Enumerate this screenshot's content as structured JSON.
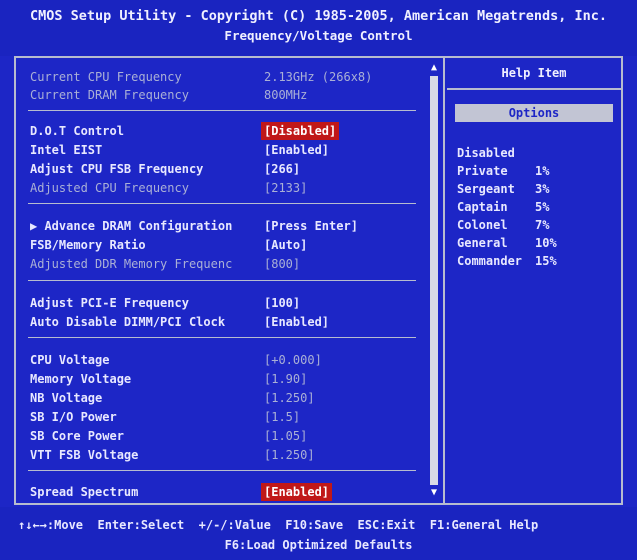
{
  "header": {
    "title": "CMOS Setup Utility - Copyright (C) 1985-2005, American Megatrends, Inc.",
    "subtitle": "Frequency/Voltage Control"
  },
  "settings": {
    "current_cpu_freq": {
      "label": "Current CPU Frequency",
      "value": "2.13GHz (266x8)"
    },
    "current_dram_freq": {
      "label": "Current DRAM Frequency",
      "value": "800MHz"
    },
    "dot_control": {
      "label": "D.O.T Control",
      "value": "[Disabled]"
    },
    "intel_eist": {
      "label": "Intel EIST",
      "value": "[Enabled]"
    },
    "adjust_fsb": {
      "label": "Adjust CPU FSB Frequency",
      "value": "[266]"
    },
    "adjusted_cpu": {
      "label": "Adjusted CPU Frequency",
      "value": "[2133]"
    },
    "advance_dram": {
      "label": "▶ Advance DRAM Configuration",
      "value": "[Press Enter]"
    },
    "fsb_mem_ratio": {
      "label": "FSB/Memory Ratio",
      "value": "[Auto]"
    },
    "adjusted_ddr": {
      "label": "Adjusted DDR Memory Frequenc",
      "value": "[800]"
    },
    "adjust_pcie": {
      "label": "Adjust PCI-E Frequency",
      "value": "[100]"
    },
    "auto_disable": {
      "label": "Auto Disable DIMM/PCI Clock",
      "value": "[Enabled]"
    },
    "cpu_voltage": {
      "label": "CPU Voltage",
      "value": "[+0.000]"
    },
    "memory_voltage": {
      "label": "Memory Voltage",
      "value": "[1.90]"
    },
    "nb_voltage": {
      "label": "NB Voltage",
      "value": "[1.250]"
    },
    "sb_io_power": {
      "label": "SB I/O Power",
      "value": "[1.5]"
    },
    "sb_core_power": {
      "label": "SB Core Power",
      "value": "[1.05]"
    },
    "vtt_fsb": {
      "label": "VTT FSB Voltage",
      "value": "[1.250]"
    },
    "spread_spectrum": {
      "label": "Spread Spectrum",
      "value": "[Enabled]"
    }
  },
  "help": {
    "title": "Help Item",
    "options_title": "Options",
    "options": [
      {
        "name": "Disabled",
        "value": ""
      },
      {
        "name": "Private",
        "value": "1%"
      },
      {
        "name": "Sergeant",
        "value": "3%"
      },
      {
        "name": "Captain",
        "value": "5%"
      },
      {
        "name": "Colonel",
        "value": "7%"
      },
      {
        "name": "General",
        "value": "10%"
      },
      {
        "name": "Commander",
        "value": "15%"
      }
    ]
  },
  "footer": {
    "line1": "↑↓←→:Move  Enter:Select  +/-/:Value  F10:Save  ESC:Exit  F1:General Help",
    "line2": "F6:Load Optimized Defaults"
  },
  "colors": {
    "background": "#1d26c6",
    "highlight": "#c01818",
    "text": "#e8e8ff",
    "dim_text": "#aab0d6"
  }
}
